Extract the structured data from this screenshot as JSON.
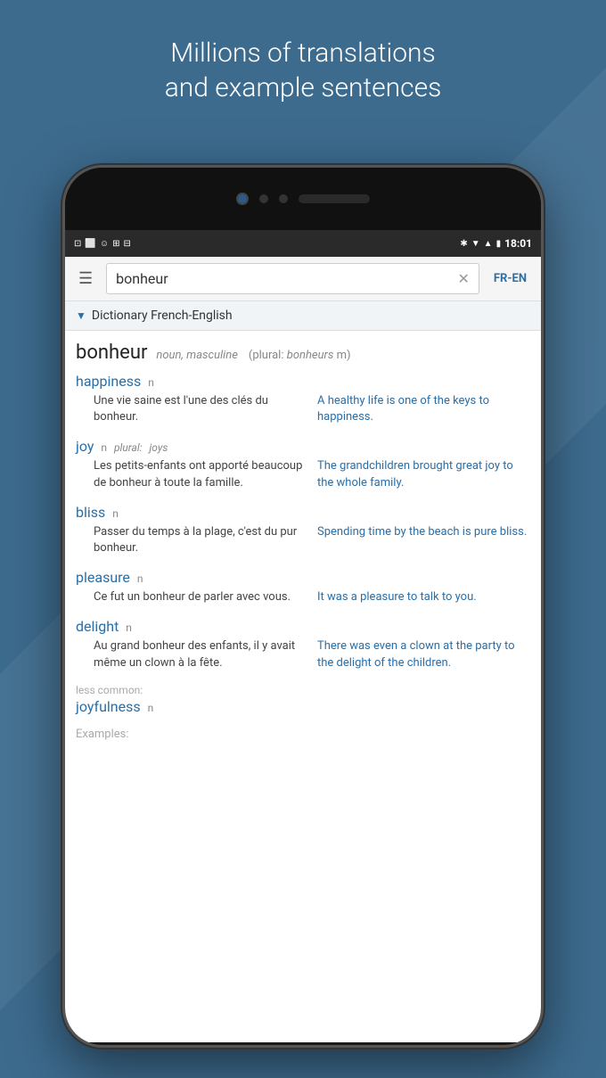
{
  "header": {
    "line1": "Millions of translations",
    "line2": "and example sentences"
  },
  "status_bar": {
    "time": "18:01",
    "icons": "★ ▼ ▲ ■ ⬛"
  },
  "toolbar": {
    "search_value": "bonheur",
    "clear_label": "✕",
    "lang_label": "FR-EN",
    "hamburger_label": "☰"
  },
  "dictionary_label": "Dictionary French-English",
  "entry": {
    "word": "bonheur",
    "pos": "noun, masculine",
    "plural_label": "plural:",
    "plural_word": "bonheurs",
    "plural_gender": "m"
  },
  "translations": [
    {
      "word": "happiness",
      "pos": "n",
      "plural": null,
      "example_fr": "Une vie saine est l'une des clés du bonheur.",
      "example_en": "A healthy life is one of the keys to happiness."
    },
    {
      "word": "joy",
      "pos": "n",
      "plural_label": "plural:",
      "plural_word": "joys",
      "example_fr": "Les petits-enfants ont apporté beaucoup de bonheur à toute la famille.",
      "example_en": "The grandchildren brought great joy to the whole family."
    },
    {
      "word": "bliss",
      "pos": "n",
      "plural": null,
      "example_fr": "Passer du temps à la plage, c'est du pur bonheur.",
      "example_en": "Spending time by the beach is pure bliss."
    },
    {
      "word": "pleasure",
      "pos": "n",
      "plural": null,
      "example_fr": "Ce fut un bonheur de parler avec vous.",
      "example_en": "It was a pleasure to talk to you."
    },
    {
      "word": "delight",
      "pos": "n",
      "plural": null,
      "example_fr": "Au grand bonheur des enfants, il y avait même un clown à la fête.",
      "example_en": "There was even a clown at the party to the delight of the children."
    }
  ],
  "less_common": {
    "label": "less common:",
    "word": "joyfulness",
    "pos": "n"
  },
  "examples_label": "Examples:"
}
